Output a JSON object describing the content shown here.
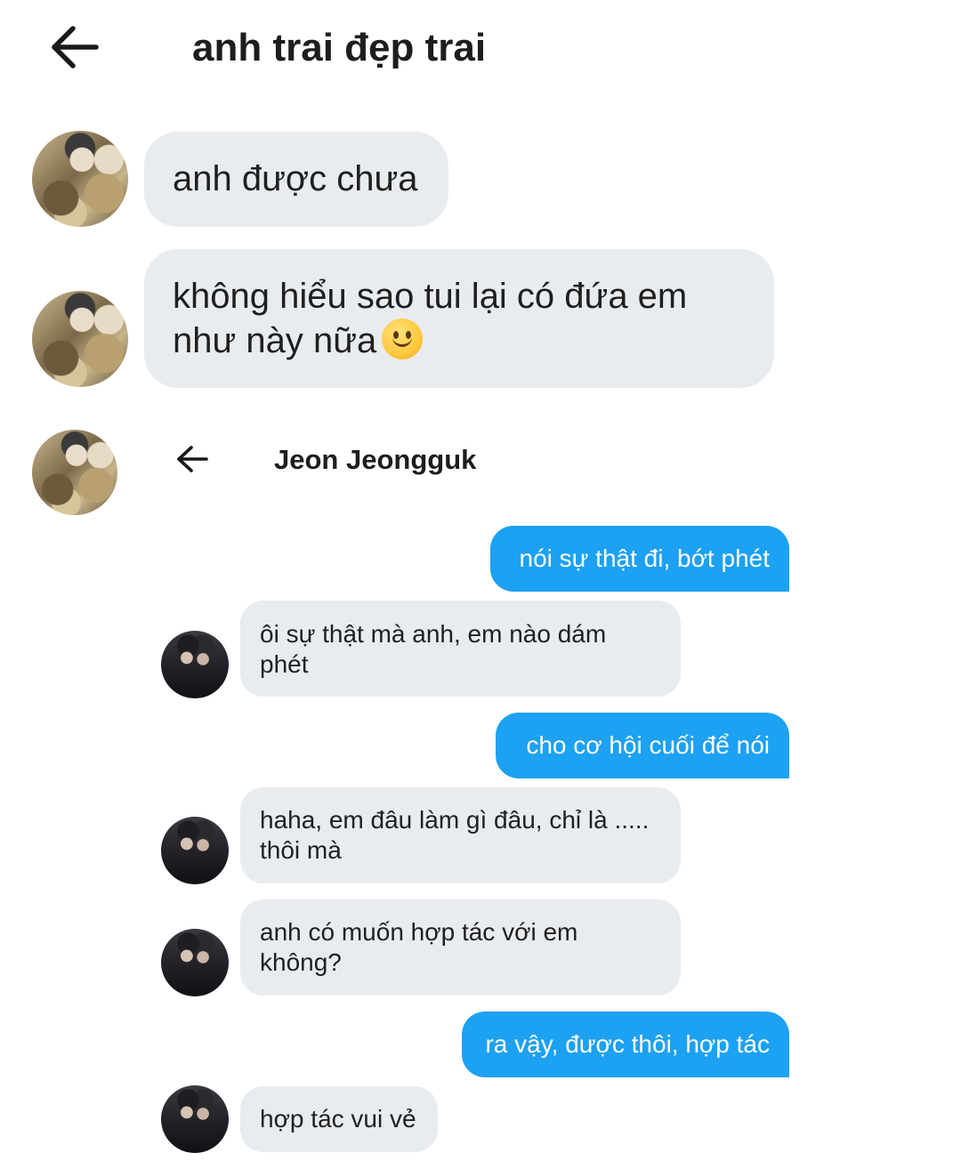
{
  "header": {
    "title": "anh trai đẹp trai"
  },
  "messages": [
    {
      "text": "anh được chưa"
    },
    {
      "text": "không hiểu sao tui lại có đứa em như này nữa",
      "emoji": "slightly-smiling-face"
    }
  ],
  "inner_chat": {
    "title": "Jeon Jeongguk",
    "messages": [
      {
        "direction": "out",
        "text": "nói sự thật đi, bớt phét"
      },
      {
        "direction": "in",
        "text": "ôi sự thật mà anh, em nào dám phét"
      },
      {
        "direction": "out",
        "text": "cho cơ hội cuối để nói"
      },
      {
        "direction": "in",
        "text": "haha, em đâu làm gì đâu, chỉ là ..... thôi mà"
      },
      {
        "direction": "in",
        "text": "anh có muốn hợp tác với em không?"
      },
      {
        "direction": "out",
        "text": "ra vậy, được thôi, hợp tác"
      },
      {
        "direction": "in",
        "text": "hợp tác vui vẻ"
      }
    ]
  },
  "colors": {
    "incoming_bubble": "#e9ecef",
    "outgoing_bubble": "#1da1f2",
    "background": "#ffffff"
  }
}
